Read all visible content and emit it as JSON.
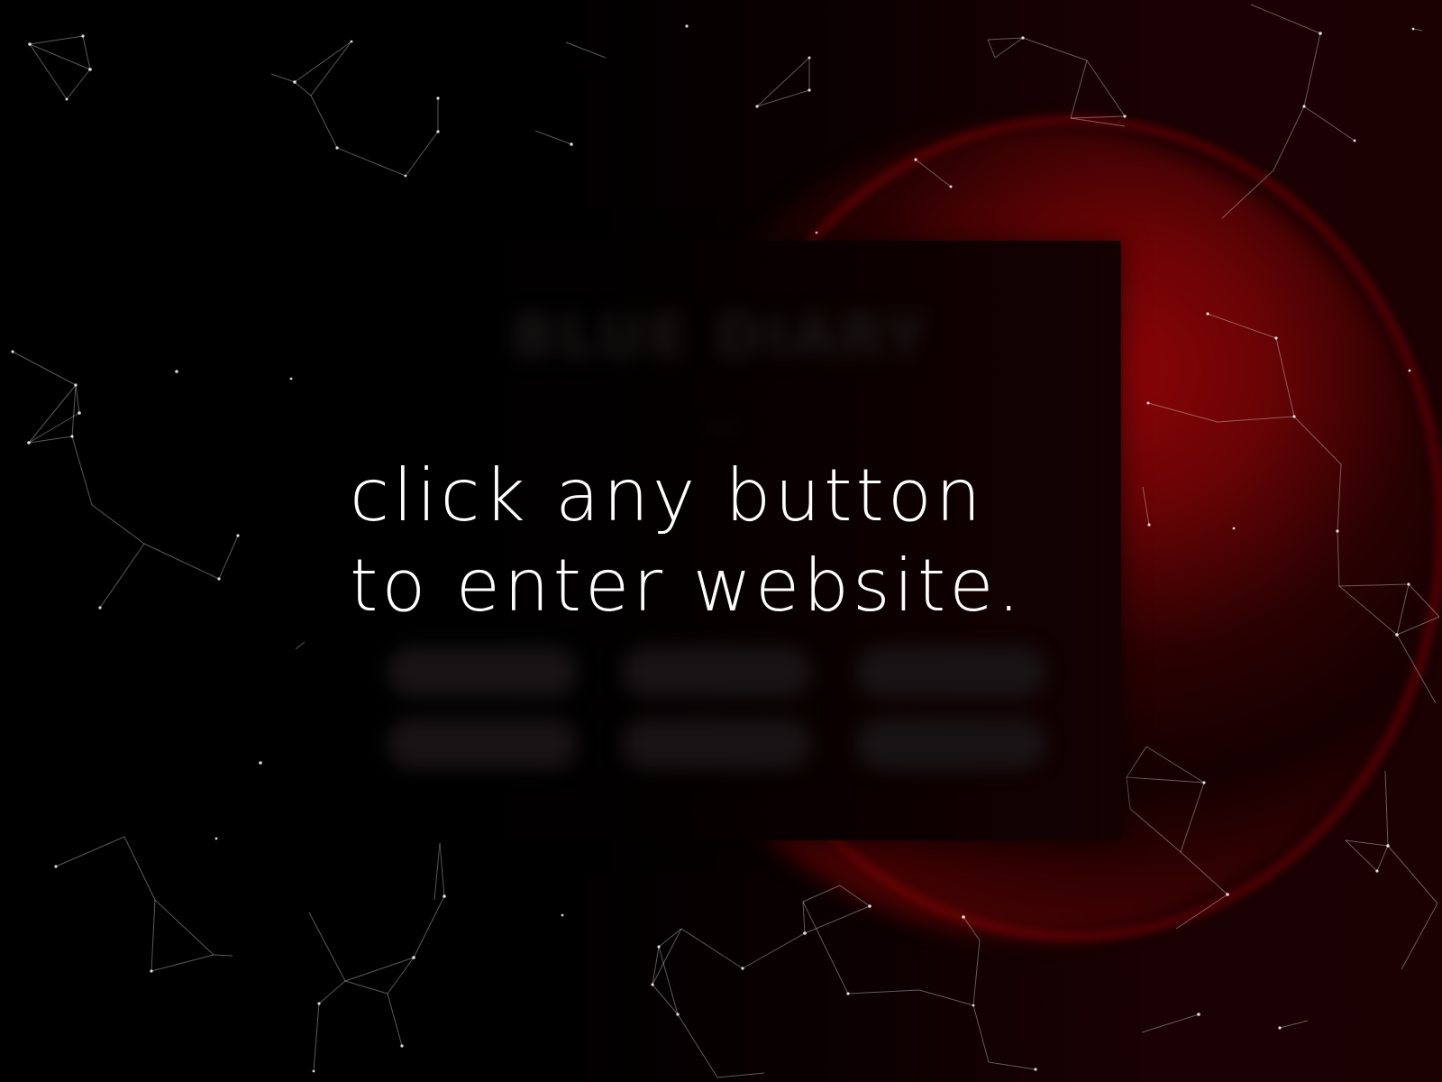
{
  "prompt": {
    "line1": "click any button",
    "line2": "to enter website."
  },
  "background_page": {
    "title": "BLUE DIARY",
    "subtitle": "***",
    "buttons": [
      "",
      "",
      "",
      "",
      "",
      ""
    ]
  },
  "colors": {
    "background": "#000000",
    "accent_red": "#8a0406",
    "text": "#ffffff"
  },
  "decoration": {
    "starfield": "constellation-network",
    "orb": "red-glowing-sphere"
  }
}
